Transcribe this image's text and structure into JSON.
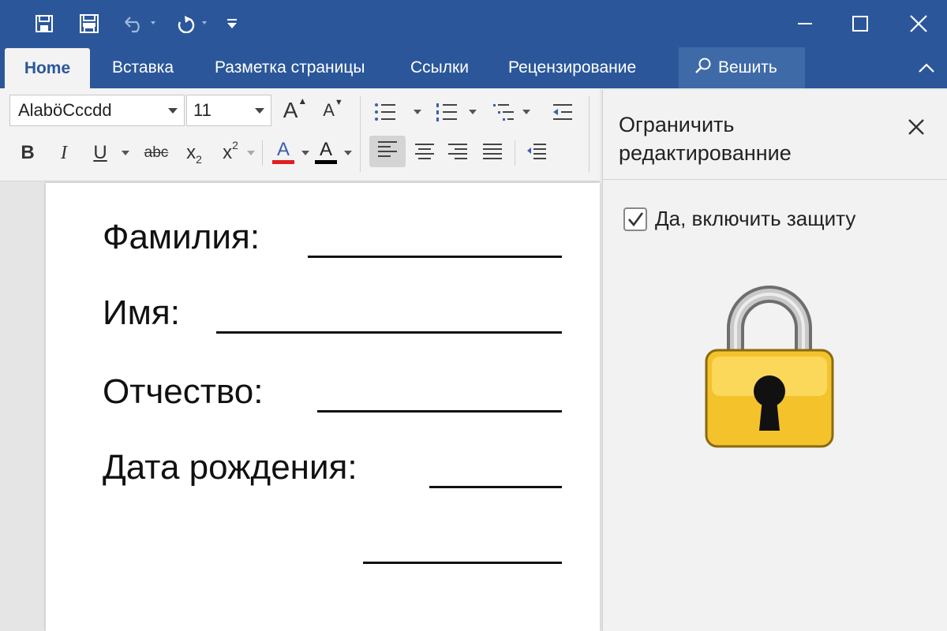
{
  "quick_access": {
    "icons": [
      "save-icon",
      "print-save-icon",
      "undo-icon",
      "redo-icon",
      "customize-icon"
    ]
  },
  "ribbon_tabs": [
    {
      "label": "Home",
      "active": true
    },
    {
      "label": "Вставка"
    },
    {
      "label": "Разметка страницы"
    },
    {
      "label": "Ссылки"
    },
    {
      "label": "Рецензирование"
    }
  ],
  "search": {
    "label": "Вешить"
  },
  "ribbon": {
    "font_name": "AlaböCccdd",
    "font_size": "11",
    "grow_font": "A",
    "shrink_font": "A",
    "bold": "B",
    "italic": "I",
    "underline": "U",
    "strike": "abc",
    "subscript": "x",
    "subscript_mark": "2",
    "superscript": "x",
    "superscript_mark": "2",
    "font_color_letter": "A",
    "highlight_letter": "A",
    "font_color": "#e02020",
    "highlight_color": "#000000"
  },
  "document": {
    "fields": [
      {
        "label": "Фамилия:"
      },
      {
        "label": "Имя:"
      },
      {
        "label": "Отчество:"
      },
      {
        "label": "Дата рождения:"
      }
    ]
  },
  "pane": {
    "title": "Ограничить редактированние",
    "checkbox_label": "Да, включить защиту",
    "checkbox_checked": true
  },
  "colors": {
    "titlebar": "#2b579a",
    "ribbon": "#f3f3f3",
    "lock_body": "#f4c22b"
  }
}
